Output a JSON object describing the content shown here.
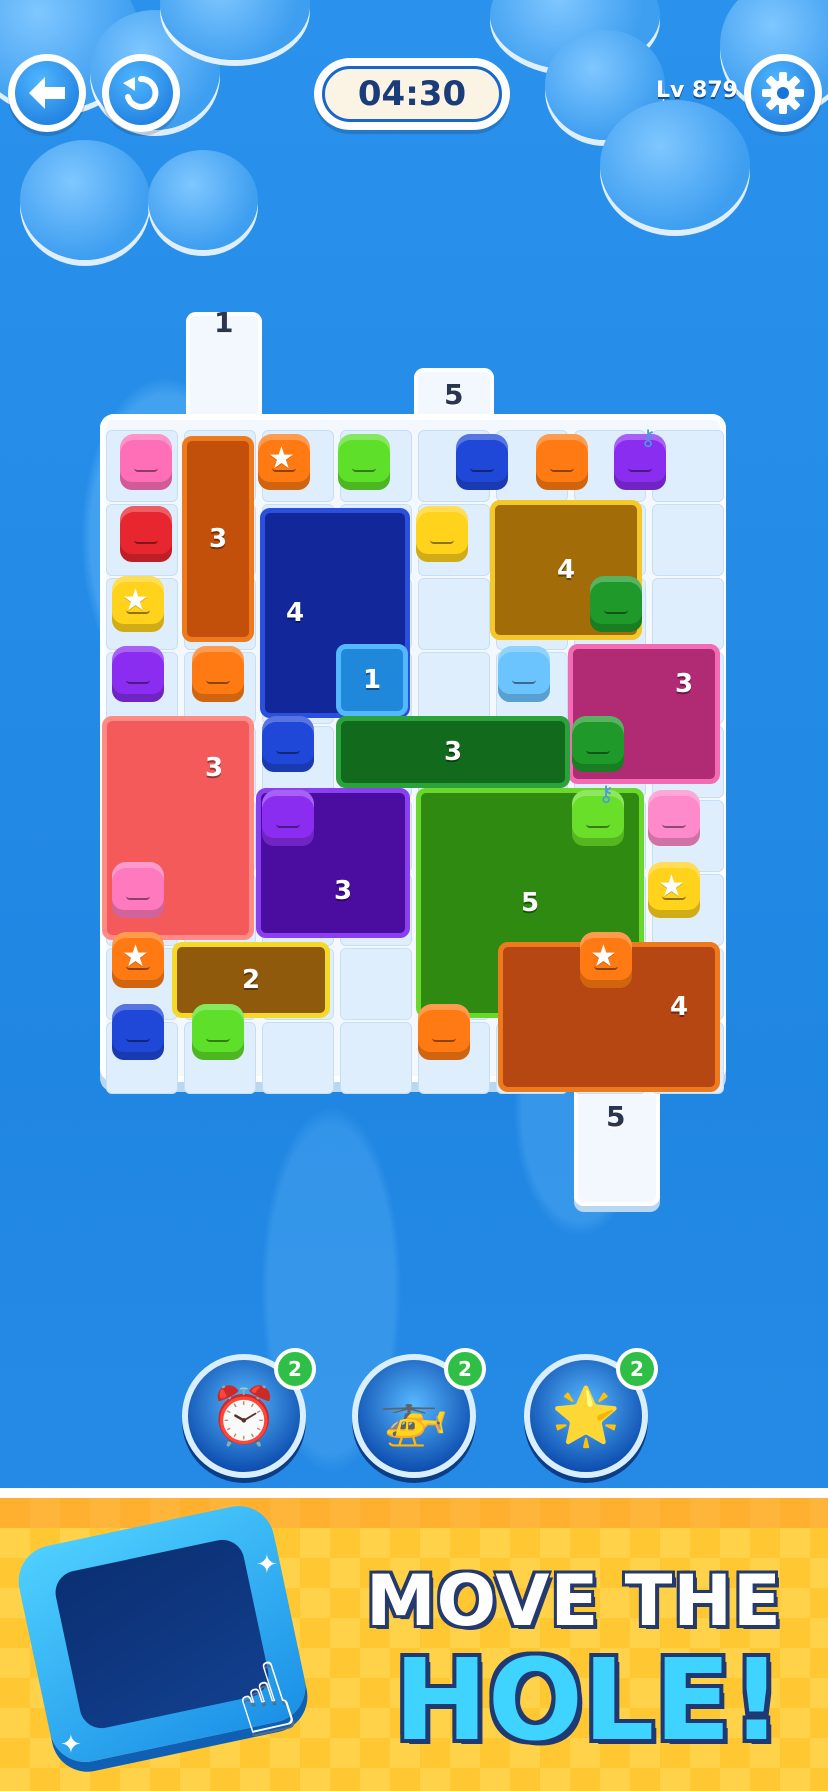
{
  "hud": {
    "back_icon": "back-arrow-icon",
    "undo_icon": "undo-icon",
    "timer": "04:30",
    "level": "Lv 879",
    "settings_icon": "gear-icon"
  },
  "gates": [
    {
      "count": "1"
    },
    {
      "count": "5"
    },
    {
      "count": "5"
    }
  ],
  "holes": [
    {
      "label": "3",
      "color": "#e0620f"
    },
    {
      "label": "4",
      "color": "#1f3fc8"
    },
    {
      "label": "4",
      "color": "#b27a0a"
    },
    {
      "label": "1",
      "color": "#2a94e6"
    },
    {
      "label": "3",
      "color": "#e0449a"
    },
    {
      "label": "3",
      "color": "#ff5a5a"
    },
    {
      "label": "3",
      "color": "#1e8f2a"
    },
    {
      "label": "3",
      "color": "#6a1fd1"
    },
    {
      "label": "5",
      "color": "#39a51a"
    },
    {
      "label": "2",
      "color": "#a87416"
    },
    {
      "label": "4",
      "color": "#d2561a"
    }
  ],
  "boosters": [
    {
      "name": "time-freeze-booster",
      "count": "2",
      "icon": "alarm-clock-icon"
    },
    {
      "name": "helicopter-booster",
      "count": "2",
      "icon": "helicopter-blob-icon"
    },
    {
      "name": "magic-booster",
      "count": "2",
      "icon": "magic-star-blob-icon"
    }
  ],
  "banner": {
    "line1": "MOVE THE",
    "line2": "HOLE!"
  },
  "colors": {
    "water": "#2a8ee8",
    "board": "#f3f8fe",
    "badge": "#2fbf46",
    "banner": "#ffd24a"
  }
}
